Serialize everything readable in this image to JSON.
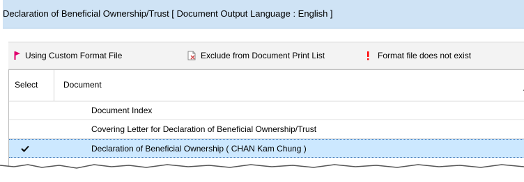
{
  "window": {
    "title": "Declaration of Beneficial Ownership/Trust [ Document Output Language : English ]"
  },
  "legend": {
    "items": [
      {
        "icon": "red-flag-icon",
        "label": "Using Custom Format File",
        "color": "#e0006e"
      },
      {
        "icon": "excluded-document-icon",
        "label": "Exclude from Document Print List",
        "color": "#d04a4a"
      },
      {
        "icon": "exclamation-icon",
        "label": "Format file does not exist",
        "color": "#ff0000"
      }
    ]
  },
  "table": {
    "columns": [
      "Select",
      "Document"
    ],
    "rows": [
      {
        "selected": false,
        "document": "Document Index"
      },
      {
        "selected": false,
        "document": "Covering Letter for Declaration of Beneficial Ownership/Trust"
      },
      {
        "selected": true,
        "document": "Declaration of Beneficial Ownership ( CHAN Kam Chung )"
      }
    ]
  },
  "colors": {
    "titlebar": "#cfe3f5",
    "selected_row": "#cce8ff"
  }
}
